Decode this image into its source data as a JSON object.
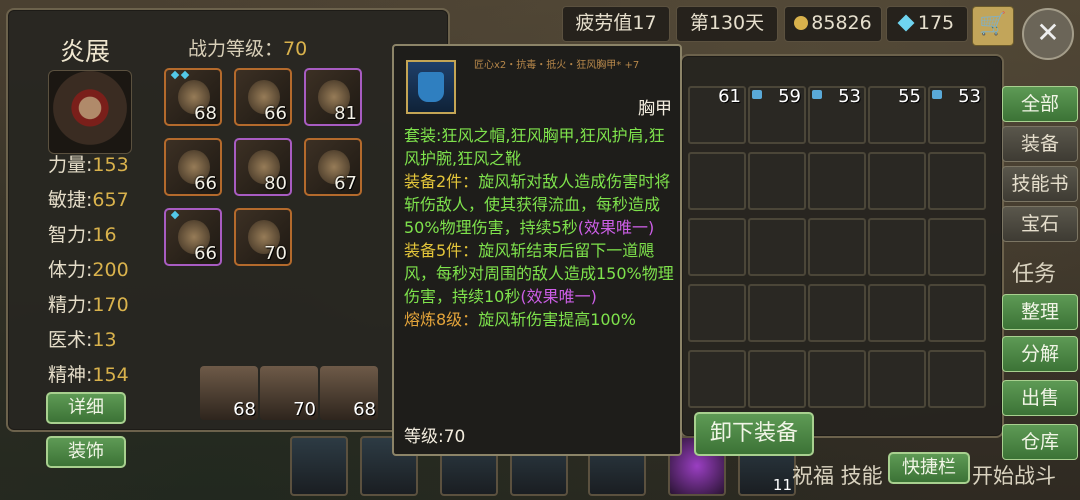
{
  "character": {
    "name": "炎展",
    "power_label": "战力等级：",
    "power_value": "70",
    "stats": [
      {
        "label": "力量:",
        "value": "153"
      },
      {
        "label": "敏捷:",
        "value": "657"
      },
      {
        "label": "智力:",
        "value": "16"
      },
      {
        "label": "体力:",
        "value": "200"
      },
      {
        "label": "精力:",
        "value": "170"
      },
      {
        "label": "医术:",
        "value": "13"
      },
      {
        "label": "精神:",
        "value": "154"
      }
    ],
    "detail_btn": "详细",
    "decor_btn": "装饰"
  },
  "equipment_levels": [
    "68",
    "66",
    "81",
    "66",
    "80",
    "67",
    "66",
    "70"
  ],
  "heroes": [
    "68",
    "70",
    "68"
  ],
  "topbar": {
    "fatigue": "疲劳值17",
    "day": "第130天",
    "gold": "85826",
    "diamonds": "175"
  },
  "tooltip": {
    "subtitle": "匠心x2・抗毒・抵火・狂风胸甲* +7",
    "item_type": "胸甲",
    "set_line": "套装:狂风之帽,狂风胸甲,狂风护肩,狂风护腕,狂风之靴",
    "bonus2_label": "装备2件：",
    "bonus2_text": "旋风斩对敌人造成伤害时将斩伤敌人，使其获得流血，每秒造成50%物理伤害，持续5秒",
    "bonus2_unique": "(效果唯一)",
    "bonus5_label": "装备5件：",
    "bonus5_text": "旋风斩结束后留下一道飓风，每秒对周围的敌人造成150%物理伤害，持续10秒",
    "bonus5_unique": "(效果唯一)",
    "forge_label": "熔炼8级：",
    "forge_text": "旋风斩伤害提高100%",
    "level": "等级:70"
  },
  "unequip_btn": "卸下装备",
  "inventory_levels": [
    "61",
    "59",
    "53",
    "55",
    "53"
  ],
  "side_menu": [
    "全部",
    "装备",
    "技能书",
    "宝石",
    "整理",
    "分解",
    "出售",
    "仓库"
  ],
  "task_label": "任务",
  "bottom": {
    "quick_bar": "快捷栏",
    "start_battle": "开始战斗",
    "skill_text": "祝福 技能",
    "badge": "11"
  },
  "colors": {
    "accent_gold": "#d9b24c",
    "set_green": "#7ee24c",
    "set_yellow": "#e3c53a",
    "unique_purple": "#cc5ee6"
  }
}
